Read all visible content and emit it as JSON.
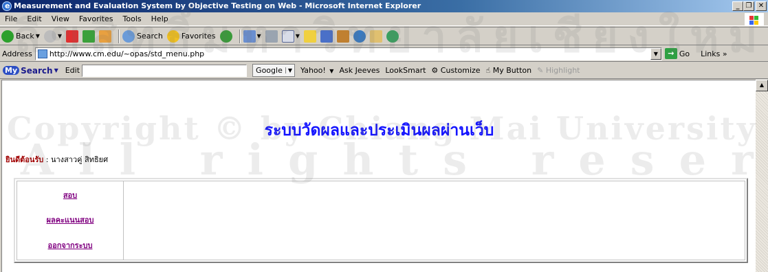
{
  "window": {
    "title": "Measurement and Evaluation System by Objective Testing on Web - Microsoft Internet Explorer",
    "buttons": [
      "_",
      "❐",
      "✕"
    ]
  },
  "menubar": {
    "items": [
      "File",
      "Edit",
      "View",
      "Favorites",
      "Tools",
      "Help"
    ]
  },
  "toolbar": {
    "back_label": "Back",
    "search_label": "Search",
    "favorites_label": "Favorites"
  },
  "address": {
    "label": "Address",
    "url": "http://www.cm.edu/~opas/std_menu.php",
    "go_label": "Go",
    "links_label": "Links"
  },
  "mysearch": {
    "logo_my": "My",
    "logo_text": "Search",
    "edit_label": "Edit",
    "engine": "Google",
    "items": [
      "Yahoo!",
      "Ask Jeeves",
      "LookSmart",
      "Customize",
      "My Button",
      "Highlight"
    ]
  },
  "page": {
    "title": "ระบบวัดผลและประเมินผลผ่านเว็บ",
    "welcome_label": "ยินดีต้อนรับ",
    "welcome_sep": " : ",
    "user_name": "นางสาวคู่ สิทธิยศ",
    "menu": [
      "สอบ",
      "ผลคะแนนสอบ",
      "ออกจากระบบ"
    ]
  },
  "watermark": {
    "line1": "ลิขสิทธิ์มหาวิทยาลัยเชียงใหม่",
    "line2": "Copyright © by Chiang Mai University",
    "line3": "All rights reserved"
  }
}
